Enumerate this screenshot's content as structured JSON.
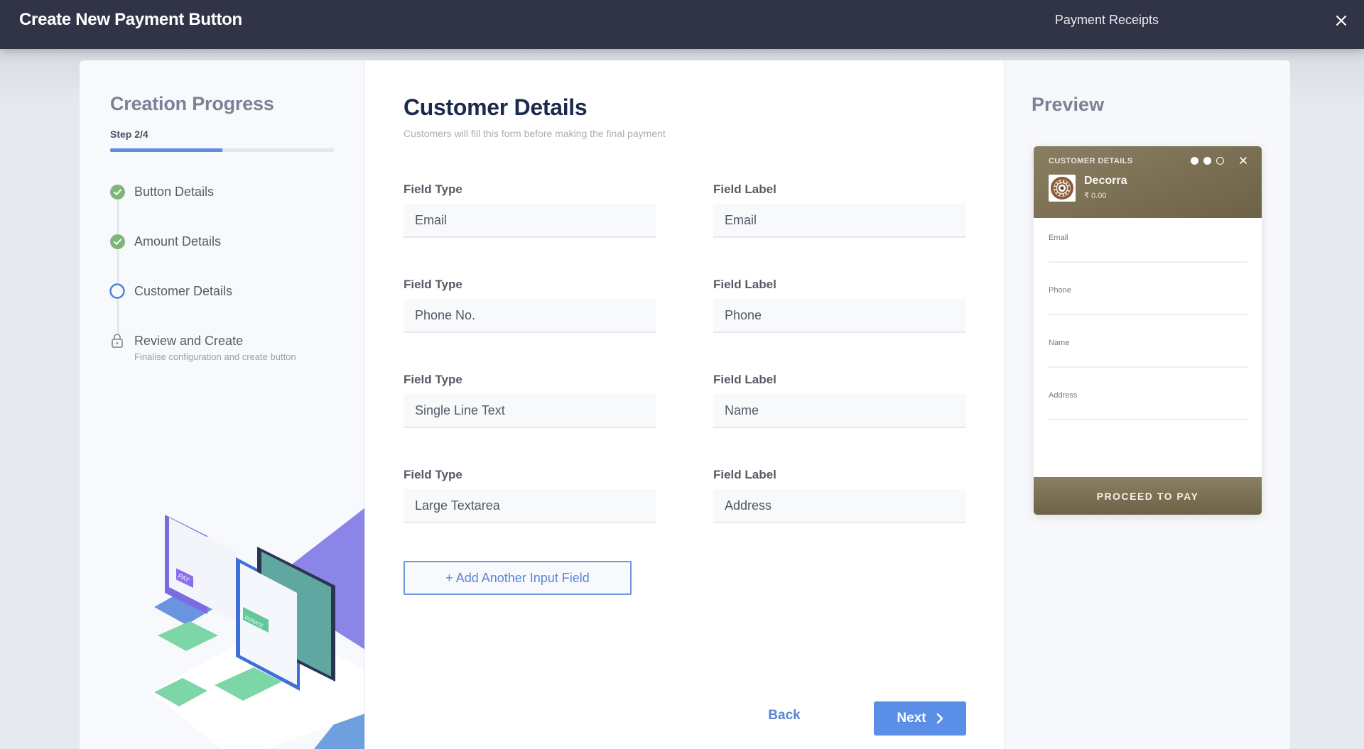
{
  "header": {
    "title": "Create New Payment Button",
    "receipts_link": "Payment Receipts",
    "close_icon": "close-icon"
  },
  "progress": {
    "title": "Creation Progress",
    "step_text": "Step 2/4",
    "fraction_complete": 0.5,
    "steps": [
      {
        "label": "Button Details",
        "status": "complete",
        "icon": "check-circle-icon",
        "subtitle": ""
      },
      {
        "label": "Amount Details",
        "status": "complete",
        "icon": "check-circle-icon",
        "subtitle": ""
      },
      {
        "label": "Customer Details",
        "status": "current",
        "icon": "empty-circle-icon",
        "subtitle": ""
      },
      {
        "label": "Review and Create",
        "status": "locked",
        "icon": "lock-icon",
        "subtitle": "Finalise configuration and create button"
      }
    ],
    "illustration": {
      "pay_label": "PAY",
      "donate_label": "DONATE"
    }
  },
  "main": {
    "title": "Customer Details",
    "subtitle": "Customers will fill this form before making the final payment",
    "type_header": "Field Type",
    "label_header": "Field Label",
    "fields": [
      {
        "type": "Email",
        "label": "Email"
      },
      {
        "type": "Phone No.",
        "label": "Phone"
      },
      {
        "type": "Single Line Text",
        "label": "Name"
      },
      {
        "type": "Large Textarea",
        "label": "Address"
      }
    ],
    "add_field_button": "+ Add Another Input Field",
    "back_button": "Back",
    "next_button": "Next"
  },
  "preview": {
    "title": "Preview",
    "card": {
      "header_title": "CUSTOMER DETAILS",
      "step_dots": [
        true,
        true,
        false
      ],
      "brand": "Decorra",
      "amount": "₹ 0.00",
      "fields": [
        "Email",
        "Phone",
        "Name",
        "Address"
      ],
      "pay_button": "PROCEED TO PAY"
    }
  },
  "colors": {
    "header_bg": "#313446",
    "accent_blue": "#5b8ee6",
    "success_green": "#80b57a",
    "brand_brown": "#7b6f53",
    "title_navy": "#1c2a4d"
  }
}
